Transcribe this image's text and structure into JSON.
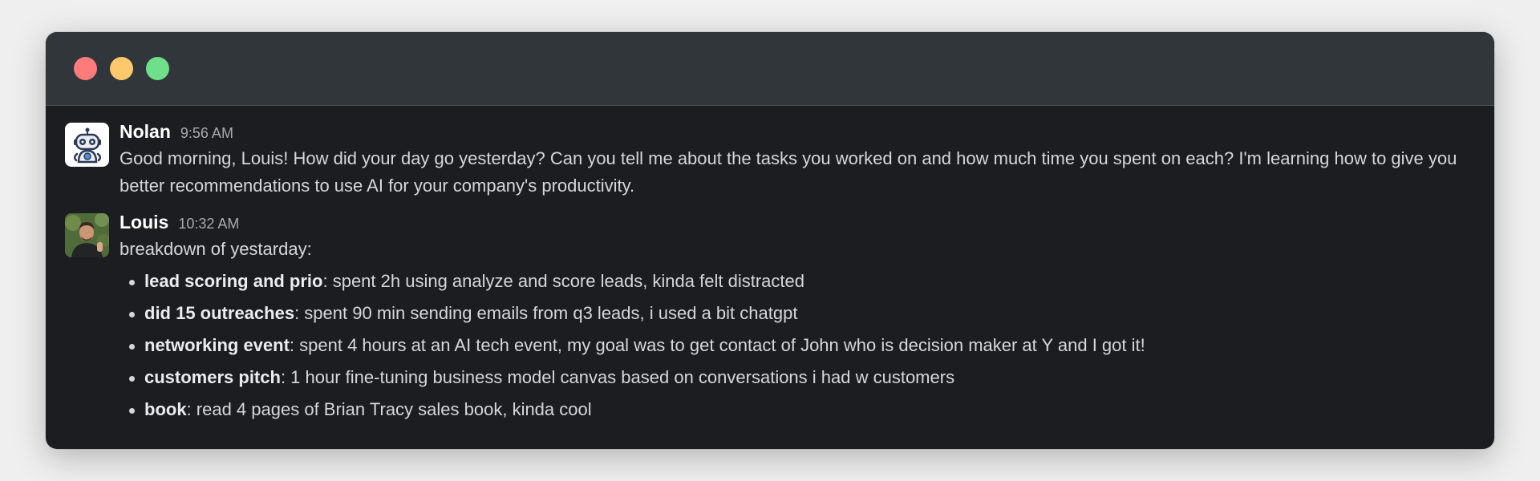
{
  "window": {
    "controls": [
      "close",
      "minimize",
      "maximize"
    ]
  },
  "messages": [
    {
      "author": "Nolan",
      "time": "9:56 AM",
      "avatar_icon": "robot-icon",
      "text": "Good morning, Louis! How did your day go yesterday? Can you tell me about the tasks you worked on and how much time you spent on each? I'm learning how to give you better recommendations to use AI for your company's productivity."
    },
    {
      "author": "Louis",
      "time": "10:32 AM",
      "avatar_icon": "user-photo",
      "intro": "breakdown of yestarday:",
      "items": [
        {
          "bold": "lead scoring and prio",
          "rest": ": spent 2h using analyze and score leads, kinda felt distracted"
        },
        {
          "bold": "did 15 outreaches",
          "rest": ": spent 90 min sending emails from q3 leads, i used a bit chatgpt"
        },
        {
          "bold": "networking event",
          "rest": ": spent 4 hours at an AI tech event, my goal was to get contact of John who is decision maker at Y and I got it!"
        },
        {
          "bold": "customers pitch",
          "rest": ": 1 hour fine-tuning business model canvas based on conversations i had w customers"
        },
        {
          "bold": "book",
          "rest": ": read 4 pages of Brian Tracy sales book, kinda cool"
        }
      ]
    }
  ],
  "colors": {
    "close": "#fd7b7b",
    "minimize": "#fec96c",
    "maximize": "#6fe089",
    "background": "#1c1d20",
    "titlebar": "#31363b"
  }
}
